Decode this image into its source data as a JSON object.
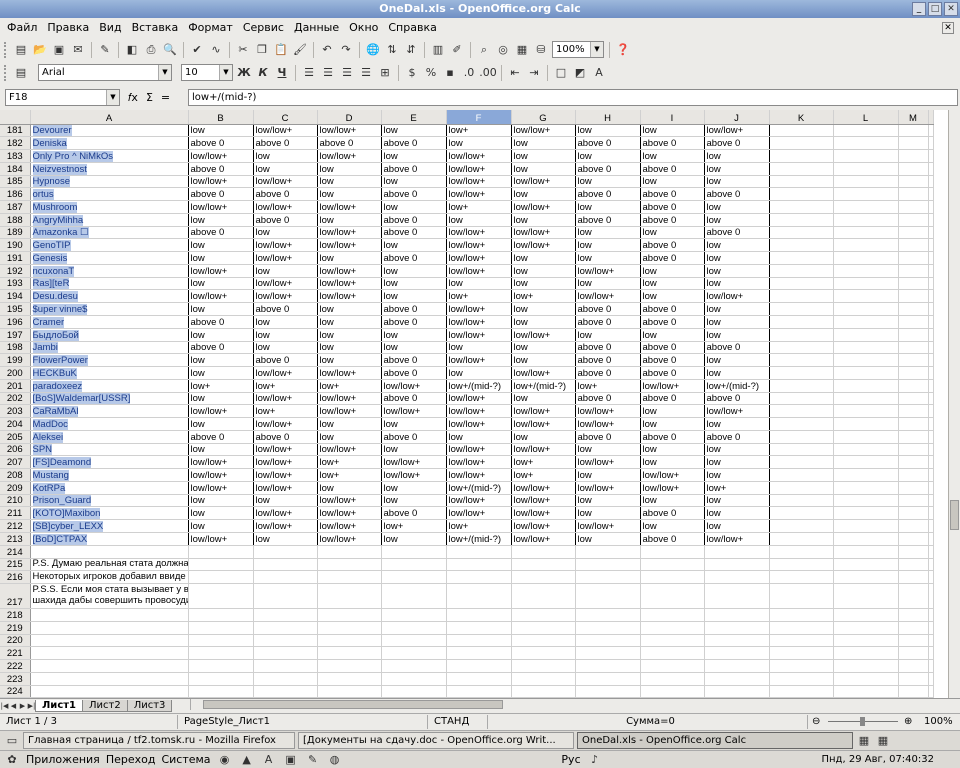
{
  "window": {
    "title": "OneDal.xls - OpenOffice.org Calc"
  },
  "menu": [
    "Файл",
    "Правка",
    "Вид",
    "Вставка",
    "Формат",
    "Сервис",
    "Данные",
    "Окно",
    "Справка"
  ],
  "toolbar": {
    "zoom": "100%",
    "font_name": "Arial",
    "font_size": "10",
    "bold": "Ж",
    "italic": "К",
    "underline": "Ч"
  },
  "formula": {
    "cell_ref": "F18",
    "fx": "𝑓x",
    "sum": "Σ",
    "eq": "=",
    "content": "low+/(mid-?)"
  },
  "columns": [
    "A",
    "B",
    "C",
    "D",
    "E",
    "F",
    "G",
    "H",
    "I",
    "J",
    "K",
    "L",
    "M"
  ],
  "selected_column": "F",
  "rows": [
    {
      "n": "181",
      "c": [
        "Devourer",
        "low",
        "low/low+",
        "low/low+",
        "low",
        "low+",
        "low/low+",
        "low",
        "low",
        "low/low+"
      ]
    },
    {
      "n": "182",
      "c": [
        "Deniska",
        "above 0",
        "above 0",
        "above 0",
        "above 0",
        "low",
        "low",
        "above 0",
        "above 0",
        "above 0"
      ]
    },
    {
      "n": "183",
      "c": [
        "Only Pro ^ NiMkOs",
        "low/low+",
        "low",
        "low/low+",
        "low",
        "low/low+",
        "low",
        "low",
        "low",
        "low"
      ]
    },
    {
      "n": "184",
      "c": [
        "Neizvestnost",
        "above 0",
        "low",
        "low",
        "above 0",
        "low/low+",
        "low",
        "above 0",
        "above 0",
        "low"
      ]
    },
    {
      "n": "185",
      "c": [
        "Hypnose",
        "low/low+",
        "low/low+",
        "low",
        "low",
        "low/low+",
        "low/low+",
        "low",
        "low",
        "low"
      ]
    },
    {
      "n": "186",
      "c": [
        "ortus",
        "above 0",
        "above 0",
        "low",
        "above 0",
        "low/low+",
        "low",
        "above 0",
        "above 0",
        "above 0"
      ]
    },
    {
      "n": "187",
      "c": [
        "Mushroom",
        "low/low+",
        "low/low+",
        "low/low+",
        "low",
        "low+",
        "low/low+",
        "low",
        "above 0",
        "low"
      ]
    },
    {
      "n": "188",
      "c": [
        "AngryMihha",
        "low",
        "above 0",
        "low",
        "above 0",
        "low",
        "low",
        "above 0",
        "above 0",
        "low"
      ]
    },
    {
      "n": "189",
      "c": [
        "Amazonka ☐",
        "above 0",
        "low",
        "low/low+",
        "above 0",
        "low/low+",
        "low/low+",
        "low",
        "low",
        "above 0"
      ]
    },
    {
      "n": "190",
      "c": [
        "GenoTIP",
        "low",
        "low/low+",
        "low/low+",
        "low",
        "low/low+",
        "low/low+",
        "low",
        "above 0",
        "low"
      ]
    },
    {
      "n": "191",
      "c": [
        "Genesis",
        "low",
        "low/low+",
        "low",
        "above 0",
        "low/low+",
        "low",
        "low",
        "above 0",
        "low"
      ]
    },
    {
      "n": "192",
      "c": [
        "ncuxonaT",
        "low/low+",
        "low",
        "low/low+",
        "low",
        "low/low+",
        "low",
        "low/low+",
        "low",
        "low"
      ]
    },
    {
      "n": "193",
      "c": [
        "Ras][teR",
        "low",
        "low/low+",
        "low/low+",
        "low",
        "low",
        "low",
        "low",
        "low",
        "low"
      ]
    },
    {
      "n": "194",
      "c": [
        "Desu.desu",
        "low/low+",
        "low/low+",
        "low/low+",
        "low",
        "low+",
        "low+",
        "low/low+",
        "low",
        "low/low+"
      ]
    },
    {
      "n": "195",
      "c": [
        "$uper vinne$",
        "low",
        "above 0",
        "low",
        "above 0",
        "low/low+",
        "low",
        "above 0",
        "above 0",
        "low"
      ]
    },
    {
      "n": "196",
      "c": [
        "Cramer",
        "above 0",
        "low",
        "low",
        "above 0",
        "low/low+",
        "low",
        "above 0",
        "above 0",
        "low"
      ]
    },
    {
      "n": "197",
      "c": [
        "БыдлоБой",
        "low",
        "low",
        "low",
        "low",
        "low/low+",
        "low/low+",
        "low",
        "low",
        "low"
      ]
    },
    {
      "n": "198",
      "c": [
        "Jambi",
        "above 0",
        "low",
        "low",
        "low",
        "low",
        "low",
        "above 0",
        "above 0",
        "above 0"
      ]
    },
    {
      "n": "199",
      "c": [
        "FlowerPower",
        "low",
        "above 0",
        "low",
        "above 0",
        "low/low+",
        "low",
        "above 0",
        "above 0",
        "low"
      ]
    },
    {
      "n": "200",
      "c": [
        "HECKBuK",
        "low",
        "low/low+",
        "low/low+",
        "above 0",
        "low",
        "low/low+",
        "above 0",
        "above 0",
        "low"
      ]
    },
    {
      "n": "201",
      "c": [
        "paradoxeez",
        "low+",
        "low+",
        "low+",
        "low/low+",
        "low+/(mid-?)",
        "low+/(mid-?)",
        "low+",
        "low/low+",
        "low+/(mid-?)"
      ]
    },
    {
      "n": "202",
      "c": [
        "[BoS]Waldemar[USSR]",
        "low",
        "low/low+",
        "low/low+",
        "above 0",
        "low/low+",
        "low",
        "above 0",
        "above 0",
        "above 0"
      ]
    },
    {
      "n": "203",
      "c": [
        "CaRaMbAl",
        "low/low+",
        "low+",
        "low/low+",
        "low/low+",
        "low/low+",
        "low/low+",
        "low/low+",
        "low",
        "low/low+"
      ]
    },
    {
      "n": "204",
      "c": [
        "MadDoc",
        "low",
        "low/low+",
        "low",
        "low",
        "low/low+",
        "low/low+",
        "low/low+",
        "low",
        "low"
      ]
    },
    {
      "n": "205",
      "c": [
        "Aleksei",
        "above 0",
        "above 0",
        "low",
        "above 0",
        "low",
        "low",
        "above 0",
        "above 0",
        "above 0"
      ]
    },
    {
      "n": "206",
      "c": [
        "SPN",
        "low",
        "low/low+",
        "low/low+",
        "low",
        "low/low+",
        "low/low+",
        "low",
        "low",
        "low"
      ]
    },
    {
      "n": "207",
      "c": [
        "[FS]Deamond",
        "low/low+",
        "low/low+",
        "low+",
        "low/low+",
        "low/low+",
        "low+",
        "low/low+",
        "low",
        "low"
      ]
    },
    {
      "n": "208",
      "c": [
        "Mustang",
        "low/low+",
        "low/low+",
        "low+",
        "low/low+",
        "low/low+",
        "low+",
        "low",
        "low/low+",
        "low"
      ]
    },
    {
      "n": "209",
      "c": [
        "KotRPa",
        "low/low+",
        "low/low+",
        "low",
        "low",
        "low+/(mid-?)",
        "low/low+",
        "low/low+",
        "low/low+",
        "low+"
      ]
    },
    {
      "n": "210",
      "c": [
        "Prison_Guard",
        "low",
        "low",
        "low/low+",
        "low",
        "low/low+",
        "low/low+",
        "low",
        "low",
        "low"
      ]
    },
    {
      "n": "211",
      "c": [
        "[KOTO]Maxibon",
        "low",
        "low/low+",
        "low/low+",
        "above 0",
        "low/low+",
        "low/low+",
        "low",
        "above 0",
        "low"
      ]
    },
    {
      "n": "212",
      "c": [
        "[SB]cyber_LEXX",
        "low",
        "low/low+",
        "low/low+",
        "low+",
        "low+",
        "low/low+",
        "low/low+",
        "low",
        "low"
      ]
    },
    {
      "n": "213",
      "c": [
        "[BoD]CTPAX",
        "low/low+",
        "low",
        "low/low+",
        "low",
        "low+/(mid-?)",
        "low/low+",
        "low",
        "above 0",
        "low/low+"
      ]
    }
  ],
  "notes": {
    "r214": "214",
    "r215": "215",
    "t215": "P.S. Думаю реальная стата должна выглядеть как-то так... Если кого-то в стате нет, значит либо не играл с таким «скиловым» перцем, либо кол. Очков >15k.",
    "r216": "216",
    "t216": "Нeкоторых игроков добавил ввиде исключения!!! Добавил от себя пару градаций ранга, что бы было не обидно, стата притянута за уши, достоверносте = 70%.",
    "r217": "217",
    "t217": "P.S.S. Если моя стата вызывает у вас приступ агрессии на религиозной почве или обижает ваше вероисповедание, убедительно прошу не надевать паранжу и пояс шахида дабы совершить провосудие во имя Аллаха, Луны и прочей подобной чепухи. Расценивайте её, как шутку бред ненормального.... :)"
  },
  "empty_rows": [
    "218",
    "219",
    "220",
    "221",
    "222",
    "223",
    "224"
  ],
  "tabs": [
    "Лист1",
    "Лист2",
    "Лист3"
  ],
  "status": {
    "sheet": "Лист 1 / 3",
    "style": "PageStyle_Лист1",
    "mode": "СТАНД",
    "sum": "Сумма=0",
    "zoom": "100%"
  },
  "taskbar": [
    "Главная страница / tf2.tomsk.ru - Mozilla Firefox",
    "[Документы на сдачу.doc - OpenOffice.org Writ...",
    "OneDal.xls - OpenOffice.org Calc"
  ],
  "panel": {
    "apps": "Приложения",
    "places": "Переход",
    "system": "Система",
    "lang": "Рус",
    "clock": "Пнд, 29 Авг, 07:40:32"
  }
}
